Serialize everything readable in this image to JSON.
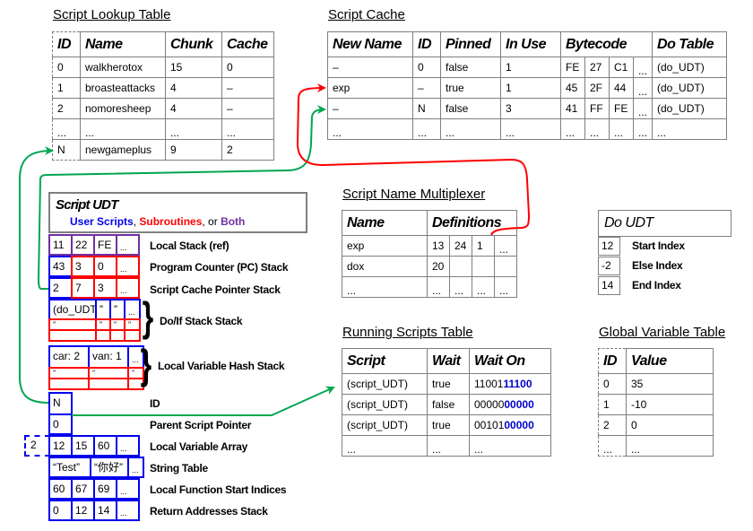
{
  "lookup": {
    "title": "Script Lookup Table",
    "headers": [
      "ID",
      "Name",
      "Chunk",
      "Cache"
    ],
    "rows": [
      [
        "0",
        "walkherotox",
        "15",
        "0"
      ],
      [
        "1",
        "broasteattacks",
        "4",
        "–"
      ],
      [
        "2",
        "nomoresheep",
        "4",
        "–"
      ],
      [
        "...",
        "...",
        "...",
        "..."
      ],
      [
        "N",
        "newgameplus",
        "9",
        "2"
      ]
    ]
  },
  "cache": {
    "title": "Script Cache",
    "headers": [
      "New Name",
      "ID",
      "Pinned",
      "In Use",
      "Bytecode",
      "Do Table"
    ],
    "rows": [
      {
        "name": "–",
        "id": "0",
        "pinned": "false",
        "inuse": "1",
        "bytes": [
          "FE",
          "27",
          "C1",
          "..."
        ],
        "do": "(do_UDT)"
      },
      {
        "name": "exp",
        "id": "–",
        "pinned": "true",
        "inuse": "1",
        "bytes": [
          "45",
          "2F",
          "44",
          "..."
        ],
        "do": "(do_UDT)"
      },
      {
        "name": "–",
        "id": "N",
        "pinned": "false",
        "inuse": "3",
        "bytes": [
          "41",
          "FF",
          "FE",
          "..."
        ],
        "do": "(do_UDT)"
      },
      {
        "name": "...",
        "id": "...",
        "pinned": "...",
        "inuse": "...",
        "bytes": [
          "...",
          "...",
          "...",
          "..."
        ],
        "do": "..."
      }
    ]
  },
  "multiplexer": {
    "title": "Script Name Multiplexer",
    "headers": [
      "Name",
      "Definitions"
    ],
    "rows": [
      {
        "name": "exp",
        "defs": [
          "13",
          "24",
          "1",
          "..."
        ]
      },
      {
        "name": "dox",
        "defs": [
          "20",
          "",
          "",
          ""
        ]
      },
      {
        "name": "...",
        "defs": [
          "...",
          "...",
          "...",
          "..."
        ]
      }
    ]
  },
  "do_udt": {
    "title": "Do  UDT",
    "fields": [
      {
        "value": "12",
        "label": "Start Index"
      },
      {
        "value": "-2",
        "label": "Else Index"
      },
      {
        "value": "14",
        "label": "End Index"
      }
    ]
  },
  "running": {
    "title": "Running Scripts Table",
    "headers": [
      "Script",
      "Wait",
      "Wait  On"
    ],
    "rows": [
      {
        "script": "(script_UDT)",
        "wait": "true",
        "bits_plain": "11001",
        "bits_blue": "11100"
      },
      {
        "script": "(script_UDT)",
        "wait": "false",
        "bits_plain": "00000",
        "bits_blue": "00000"
      },
      {
        "script": "(script_UDT)",
        "wait": "true",
        "bits_plain": "00101",
        "bits_blue": "00000"
      },
      {
        "script": "...",
        "wait": "...",
        "bits_plain": "...",
        "bits_blue": ""
      }
    ]
  },
  "globals": {
    "title": "Global Variable Table",
    "headers": [
      "ID",
      "Value"
    ],
    "rows": [
      [
        "0",
        "35"
      ],
      [
        "1",
        "-10"
      ],
      [
        "2",
        "0"
      ],
      [
        "...",
        "..."
      ]
    ]
  },
  "script_udt": {
    "title": "Script UDT",
    "legend": {
      "user": "User Scripts",
      "sep1": ", ",
      "sub": "Subroutines",
      "sep2": ", or ",
      "both": "Both"
    },
    "colors": {
      "user": "#0000ee",
      "sub": "#ff0000",
      "both": "#7030a0"
    },
    "local_stack": {
      "label": "Local Stack (ref)",
      "cells": [
        "11",
        "22",
        "FE",
        "..."
      ]
    },
    "pc_stack": {
      "label": "Program Counter (PC) Stack",
      "cells": [
        "43",
        "3",
        "0",
        "..."
      ]
    },
    "cache_ptr_stack": {
      "label": "Script Cache Pointer Stack",
      "cells": [
        "2",
        "7",
        "3",
        "..."
      ]
    },
    "do_if_stack": {
      "label": "Do/If Stack Stack",
      "row1": [
        "(do_UDT)",
        "”",
        "”",
        "..."
      ],
      "row2": [
        "”",
        "”",
        "”",
        "”"
      ],
      "row3": [
        "...",
        "...",
        "...",
        "..."
      ]
    },
    "hash_stack": {
      "label": "Local Variable Hash Stack",
      "row1": [
        "car: 2",
        "van: 1",
        "..."
      ],
      "row2": [
        "”",
        "”",
        "”"
      ],
      "row3": [
        "...",
        "...",
        "..."
      ]
    },
    "id": {
      "label": "ID",
      "value": "N"
    },
    "parent": {
      "label": "Parent Script Pointer",
      "value": "0"
    },
    "local_vars": {
      "label": "Local Variable Array",
      "count": "2",
      "cells": [
        "12",
        "15",
        "60",
        "..."
      ]
    },
    "strings": {
      "label": "String Table",
      "cells": [
        "“Test”",
        "“你好”",
        "..."
      ]
    },
    "func_starts": {
      "label": "Local Function Start Indices",
      "cells": [
        "60",
        "67",
        "69",
        "..."
      ]
    },
    "return_stack": {
      "label": "Return Addresses Stack",
      "cells": [
        "0",
        "12",
        "14",
        "..."
      ]
    }
  },
  "arrow_colors": {
    "green": "#00a651",
    "red": "#ff0000"
  }
}
